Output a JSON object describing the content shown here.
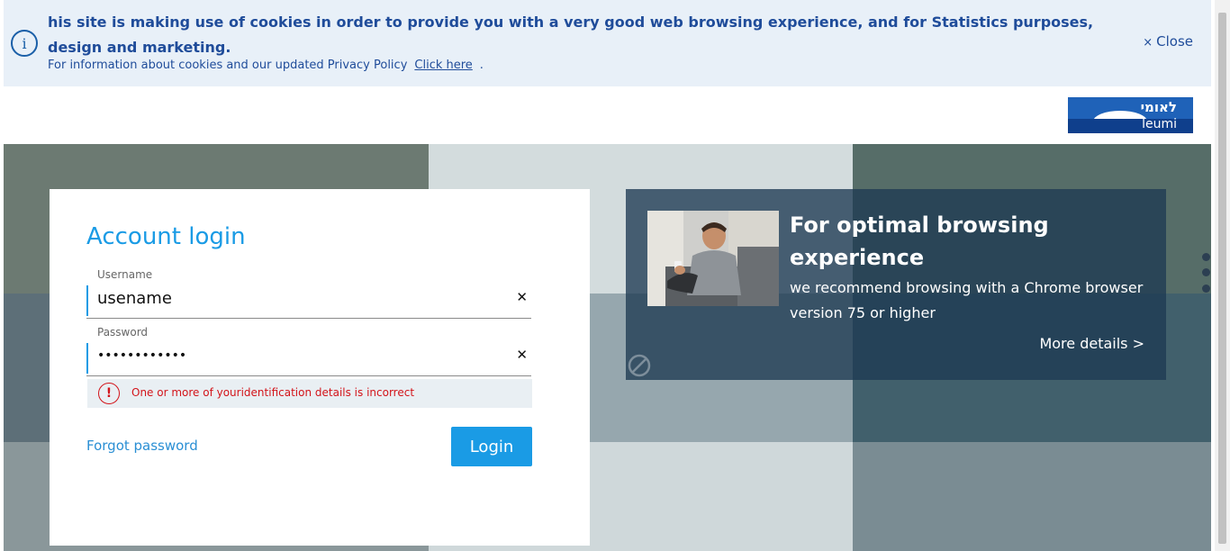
{
  "cookie_bar": {
    "icon": "info-icon",
    "message": "his site is making use of cookies in order to provide you with a very good web browsing experience, and for Statistics purposes, design and marketing.",
    "sub_message": "For information about cookies and our updated Privacy Policy",
    "link_label": "Click here",
    "trailing": ".",
    "close_glyph": "×",
    "close_label": "Close"
  },
  "header": {
    "logo_hebrew": "לאומי",
    "logo_english": "leumi"
  },
  "login": {
    "title": "Account login",
    "username_label": "Username",
    "username_value": "usename",
    "password_label": "Password",
    "password_value": "••••••••••••",
    "clear_glyph": "✕",
    "error_icon": "!",
    "error_message": "One or more of youridentification details is incorrect",
    "forgot_label": "Forgot password",
    "login_label": "Login"
  },
  "browser_notice": {
    "title": "For optimal browsing experience",
    "body": "we recommend browsing with a Chrome browser version 75 or higher",
    "more_label": "More details >"
  },
  "colors": {
    "brand_blue": "#1a9be5",
    "cookie_text": "#1f4c9a",
    "error_red": "#d3141a"
  }
}
